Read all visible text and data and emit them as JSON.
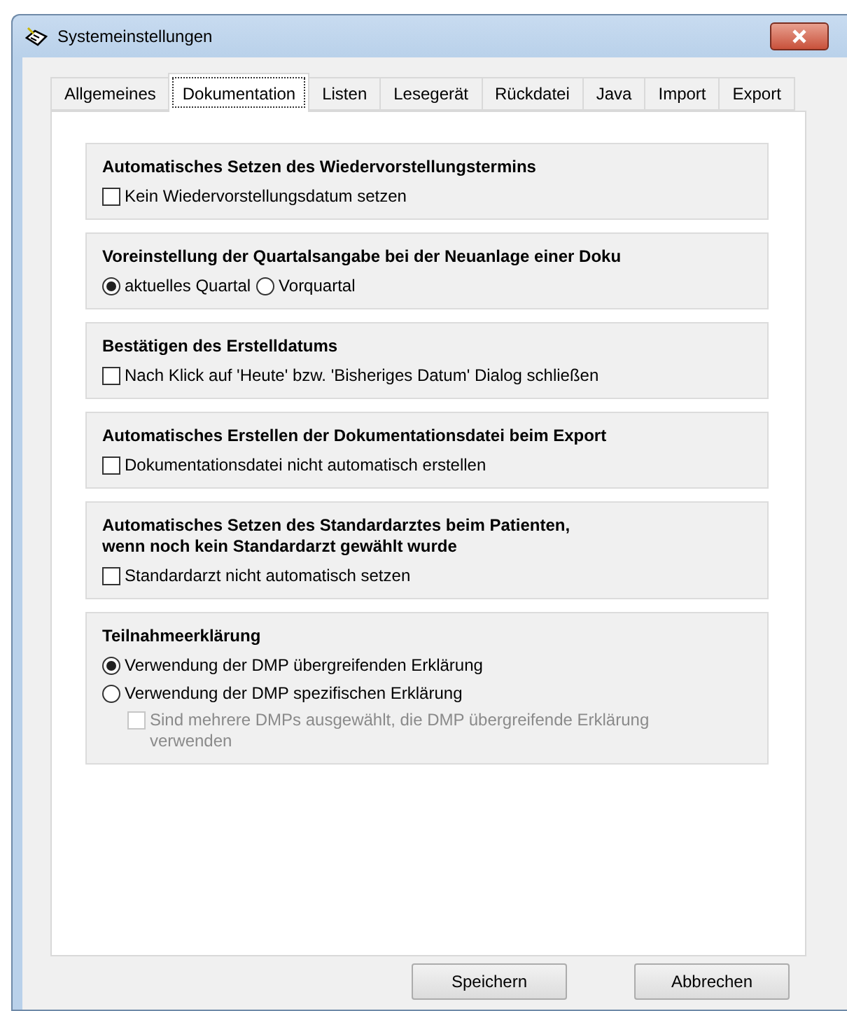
{
  "window": {
    "title": "Systemeinstellungen"
  },
  "tabs": [
    {
      "label": "Allgemeines",
      "selected": false
    },
    {
      "label": "Dokumentation",
      "selected": true
    },
    {
      "label": "Listen",
      "selected": false
    },
    {
      "label": "Lesegerät",
      "selected": false
    },
    {
      "label": "Rückdatei",
      "selected": false
    },
    {
      "label": "Java",
      "selected": false
    },
    {
      "label": "Import",
      "selected": false
    },
    {
      "label": "Export",
      "selected": false
    }
  ],
  "groups": [
    {
      "title": "Automatisches Setzen des Wiedervorstellungstermins",
      "options": [
        {
          "kind": "checkbox",
          "label": "Kein Wiedervorstellungsdatum setzen",
          "checked": false
        }
      ]
    },
    {
      "title": "Voreinstellung der Quartalsangabe bei der Neuanlage einer Doku",
      "inline": true,
      "options": [
        {
          "kind": "radio",
          "label": "aktuelles Quartal",
          "selected": true
        },
        {
          "kind": "radio",
          "label": "Vorquartal",
          "selected": false
        }
      ]
    },
    {
      "title": "Bestätigen des Erstelldatums",
      "options": [
        {
          "kind": "checkbox",
          "label": "Nach Klick auf 'Heute' bzw. 'Bisheriges Datum' Dialog schließen",
          "checked": false
        }
      ]
    },
    {
      "title": "Automatisches Erstellen der Dokumentationsdatei beim Export",
      "options": [
        {
          "kind": "checkbox",
          "label": "Dokumentationsdatei nicht automatisch erstellen",
          "checked": false
        }
      ]
    },
    {
      "title": "Automatisches Setzen des Standardarztes beim Patienten,\nwenn noch kein Standardarzt gewählt wurde",
      "options": [
        {
          "kind": "checkbox",
          "label": "Standardarzt nicht automatisch setzen",
          "checked": false
        }
      ]
    },
    {
      "title": "Teilnahmeerklärung",
      "options": [
        {
          "kind": "radio",
          "label": "Verwendung der DMP übergreifenden Erklärung",
          "selected": true
        },
        {
          "kind": "radio",
          "label": "Verwendung der DMP spezifischen Erklärung",
          "selected": false,
          "children": [
            {
              "kind": "checkbox",
              "label": "Sind mehrere DMPs ausgewählt, die DMP übergreifende Erklärung\nverwenden",
              "checked": false,
              "disabled": true
            }
          ]
        }
      ]
    }
  ],
  "buttons": [
    {
      "label": "Speichern"
    },
    {
      "label": "Abbrechen"
    }
  ]
}
